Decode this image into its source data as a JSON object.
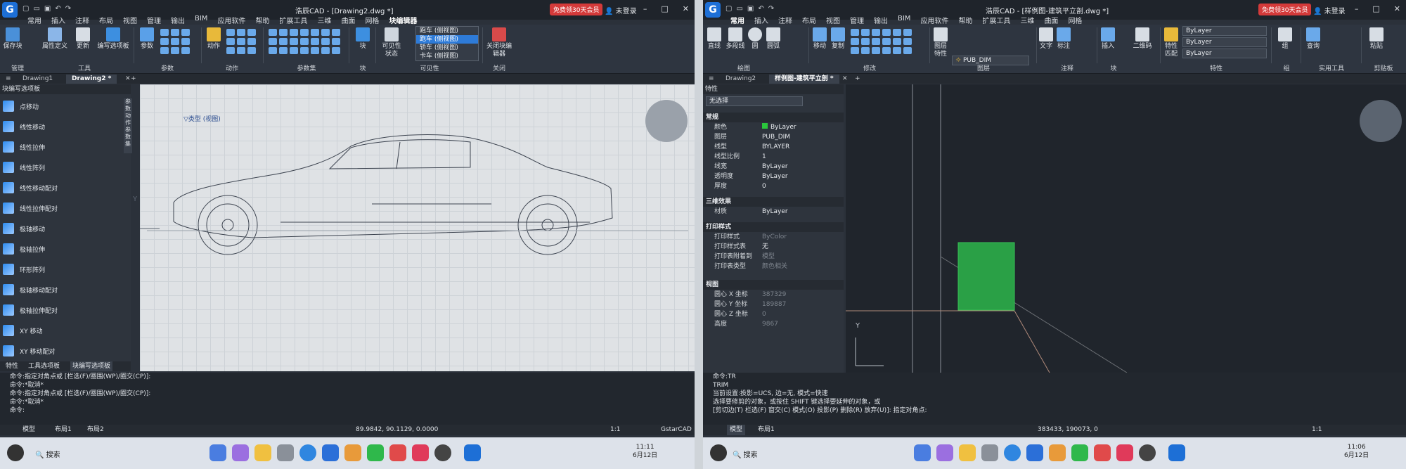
{
  "left_window": {
    "title": "浩辰CAD - [Drawing2.dwg *]",
    "vip": "免费领30天会员",
    "login": "未登录",
    "menu": [
      "常用",
      "插入",
      "注释",
      "布局",
      "视图",
      "管理",
      "输出",
      "BIM",
      "应用软件",
      "帮助",
      "扩展工具",
      "三维",
      "曲面",
      "网格",
      "块编辑器"
    ],
    "ribbon_groups": [
      {
        "label": "管理",
        "buttons": [
          "保存块",
          "属性定义"
        ]
      },
      {
        "label": "工具",
        "buttons": [
          "更新",
          "编写选项板"
        ]
      },
      {
        "label": "参数",
        "buttons": [
          "参数"
        ]
      },
      {
        "label": "动作",
        "buttons": [
          "动作"
        ]
      },
      {
        "label": "参数集",
        "buttons": []
      },
      {
        "label": "块",
        "buttons": [
          "块"
        ]
      },
      {
        "label": "可见性",
        "buttons": [
          "可见性状态"
        ]
      },
      {
        "label": "关闭",
        "buttons": [
          "关闭块编辑器"
        ]
      }
    ],
    "visibility_dropdown": {
      "selected": "跑车 (侧视图)",
      "options": [
        "跑车 (侧视图)",
        "轿车 (侧视图)",
        "卡车 (侧视图)"
      ]
    },
    "tabs": [
      "Drawing1",
      "Drawing2 *"
    ],
    "palette_title": "块编写选项板",
    "palette_items": [
      "点移动",
      "线性移动",
      "线性拉伸",
      "线性阵列",
      "线性移动配对",
      "线性拉伸配对",
      "极轴移动",
      "极轴拉伸",
      "环形阵列",
      "极轴移动配对",
      "极轴拉伸配对",
      "XY 移动",
      "XY 移动配对"
    ],
    "palette_vtabs": [
      "参数",
      "动作",
      "参数集"
    ],
    "palette_bottom_tabs": [
      "特性",
      "工具选项板",
      "块编写选项板"
    ],
    "canvas_label": "类型 (视图)",
    "axis_y": "Y",
    "command_lines": [
      "命令:指定对角点或 [栏选(F)/圈围(WP)/圈交(CP)]:",
      "命令:*取消*",
      "命令:指定对角点或 [栏选(F)/圈围(WP)/圈交(CP)]:",
      "命令:*取消*",
      "命令:"
    ],
    "layout_tabs": [
      "模型",
      "布局1",
      "布局2"
    ],
    "coords": "89.9842, 90.1129, 0.0000",
    "brand": "GstarCAD",
    "zoom": "1:1",
    "search": "搜索",
    "time": "11:11",
    "date": "6月12日"
  },
  "right_window": {
    "title": "浩辰CAD - [样例图-建筑平立剖.dwg *]",
    "vip": "免费领30天会员",
    "login": "未登录",
    "menu": [
      "常用",
      "插入",
      "注释",
      "布局",
      "视图",
      "管理",
      "输出",
      "BIM",
      "应用软件",
      "帮助",
      "扩展工具",
      "三维",
      "曲面",
      "网格"
    ],
    "ribbon_groups": [
      {
        "label": "绘图",
        "buttons": [
          "直线",
          "多段线",
          "圆",
          "圆弧"
        ]
      },
      {
        "label": "修改",
        "buttons": [
          "移动",
          "复制"
        ]
      },
      {
        "label": "图层",
        "buttons": [
          "图层特性"
        ]
      },
      {
        "label": "注释",
        "buttons": [
          "文字",
          "标注"
        ]
      },
      {
        "label": "块",
        "buttons": [
          "插入"
        ]
      },
      {
        "label": "",
        "buttons": [
          "二维码"
        ]
      },
      {
        "label": "特性",
        "buttons": [
          "特性匹配"
        ]
      },
      {
        "label": "组",
        "buttons": [
          "组"
        ]
      },
      {
        "label": "实用工具",
        "buttons": [
          "查询"
        ]
      },
      {
        "label": "剪贴板",
        "buttons": [
          "粘贴"
        ]
      }
    ],
    "layer_name": "PUB_DIM",
    "bylayer_dropdowns": [
      "ByLayer",
      "ByLayer",
      "ByLayer"
    ],
    "tabs": [
      "Drawing2",
      "样例图-建筑平立剖 *"
    ],
    "props_title": "特性",
    "selection": "无选择",
    "sections": {
      "general": {
        "title": "常规",
        "rows": [
          [
            "颜色",
            "ByLayer"
          ],
          [
            "图层",
            "PUB_DIM"
          ],
          [
            "线型",
            "BYLAYER"
          ],
          [
            "线型比例",
            "1"
          ],
          [
            "线宽",
            "ByLayer"
          ],
          [
            "透明度",
            "ByLayer"
          ],
          [
            "厚度",
            "0"
          ]
        ]
      },
      "three_d": {
        "title": "三维效果",
        "rows": [
          [
            "材质",
            "ByLayer"
          ]
        ]
      },
      "plot": {
        "title": "打印样式",
        "rows": [
          [
            "打印样式",
            "ByColor"
          ],
          [
            "打印样式表",
            "无"
          ],
          [
            "打印表附着到",
            "模型"
          ],
          [
            "打印表类型",
            "颜色相关"
          ]
        ]
      },
      "view": {
        "title": "视图",
        "rows": [
          [
            "圆心 X 坐标",
            "387329"
          ],
          [
            "圆心 Y 坐标",
            "189887"
          ],
          [
            "圆心 Z 坐标",
            "0"
          ],
          [
            "高度",
            "9867"
          ]
        ]
      }
    },
    "axis_y": "Y",
    "command_lines": [
      "命令:TR",
      "TRIM",
      "当前设置:投影=UCS, 边=无, 模式=快速",
      "选择要修剪的对象，或按住 SHIFT 键选择要延伸的对象，或",
      "[剪切边(T) 栏选(F) 窗交(C) 模式(O) 投影(P) 删除(R) 放弃(U)]: 指定对角点:"
    ],
    "layout_tabs": [
      "模型",
      "布局1"
    ],
    "coords": "383433, 190073, 0",
    "zoom": "1:1",
    "search": "搜索",
    "time": "11:06",
    "date": "6月12日"
  },
  "colors": {
    "accent": "#2e7bd8",
    "green_block": "#2aa046",
    "vip_red": "#d43a3a"
  }
}
